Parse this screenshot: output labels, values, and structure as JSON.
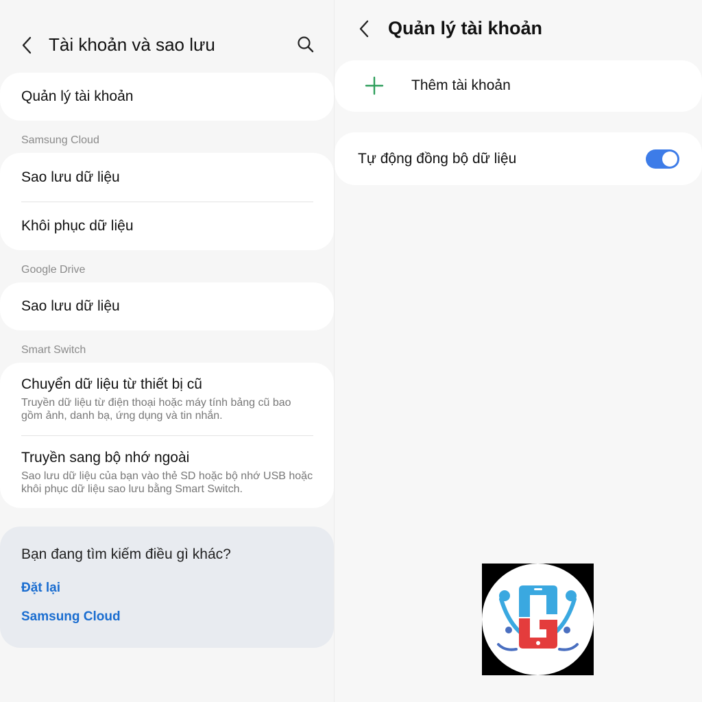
{
  "left": {
    "title": "Tài khoản và sao lưu",
    "manage_accounts": "Quản lý tài khoản",
    "sections": {
      "samsung_cloud": {
        "label": "Samsung Cloud",
        "backup": "Sao lưu dữ liệu",
        "restore": "Khôi phục dữ liệu"
      },
      "google_drive": {
        "label": "Google Drive",
        "backup": "Sao lưu dữ liệu"
      },
      "smart_switch": {
        "label": "Smart Switch",
        "transfer_title": "Chuyển dữ liệu từ thiết bị cũ",
        "transfer_sub_1": "Truyền dữ liệu từ điện thoại hoặc máy tính bảng cũ bao",
        "transfer_sub_2": "gồm ảnh, danh bạ, ứng dụng và tin nhắn.",
        "external_title": "Truyền sang bộ nhớ ngoài",
        "external_sub_1": "Sao lưu dữ liệu của bạn vào thẻ SD hoặc bộ nhớ USB hoặc",
        "external_sub_2": "khôi phục dữ liệu sao lưu bằng Smart Switch."
      }
    },
    "suggest": {
      "title": "Bạn đang tìm kiếm điều gì khác?",
      "links": [
        "Đặt lại",
        "Samsung Cloud"
      ]
    }
  },
  "right": {
    "title": "Quản lý tài khoản",
    "add_account": "Thêm tài khoản",
    "auto_sync": "Tự động đồng bộ dữ liệu",
    "auto_sync_on": true
  },
  "colors": {
    "accent_blue": "#3d7ce8",
    "link_blue": "#1a6dd0",
    "plus_green": "#2e9e5b"
  },
  "icons": [
    "back-arrow-icon",
    "search-icon",
    "plus-icon",
    "toggle-switch",
    "logo"
  ]
}
